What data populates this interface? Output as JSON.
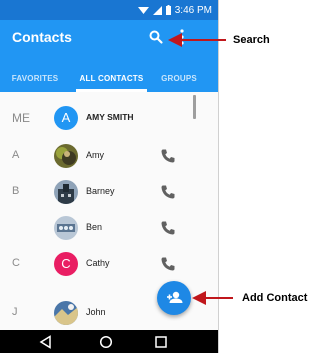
{
  "status_bar": {
    "time": "3:46 PM"
  },
  "app_bar": {
    "title": "Contacts"
  },
  "tabs": [
    {
      "label": "FAVORITES",
      "active": false
    },
    {
      "label": "ALL CONTACTS",
      "active": true
    },
    {
      "label": "GROUPS",
      "active": false
    }
  ],
  "me_row": {
    "section": "ME",
    "avatar_letter": "A",
    "name": "AMY SMITH",
    "avatar_color": "#2196f3"
  },
  "contacts": [
    {
      "section": "A",
      "name": "Amy",
      "avatar": "photo",
      "call_icon": true
    },
    {
      "section": "B",
      "name": "Barney",
      "avatar": "photo",
      "call_icon": true
    },
    {
      "section": "",
      "name": "Ben",
      "avatar": "photo",
      "call_icon": true
    },
    {
      "section": "C",
      "name": "Cathy",
      "avatar": "letter",
      "avatar_letter": "C",
      "avatar_color": "#e91e63",
      "call_icon": true
    },
    {
      "section": "J",
      "name": "John",
      "avatar": "photo",
      "call_icon": false
    }
  ],
  "callouts": {
    "search": "Search",
    "add_contact": "Add Contact"
  },
  "colors": {
    "status_bar": "#1976d2",
    "app_bar": "#2196f3",
    "fab": "#1e88e5",
    "callout_arrow": "#c0171c",
    "call_icon": "#616161"
  },
  "icons": {
    "search": "search-icon",
    "more": "more-vert-icon",
    "call": "phone-icon",
    "fab": "add-person-icon",
    "nav_back": "back-triangle-icon",
    "nav_home": "home-circle-icon",
    "nav_recents": "recents-square-icon"
  }
}
